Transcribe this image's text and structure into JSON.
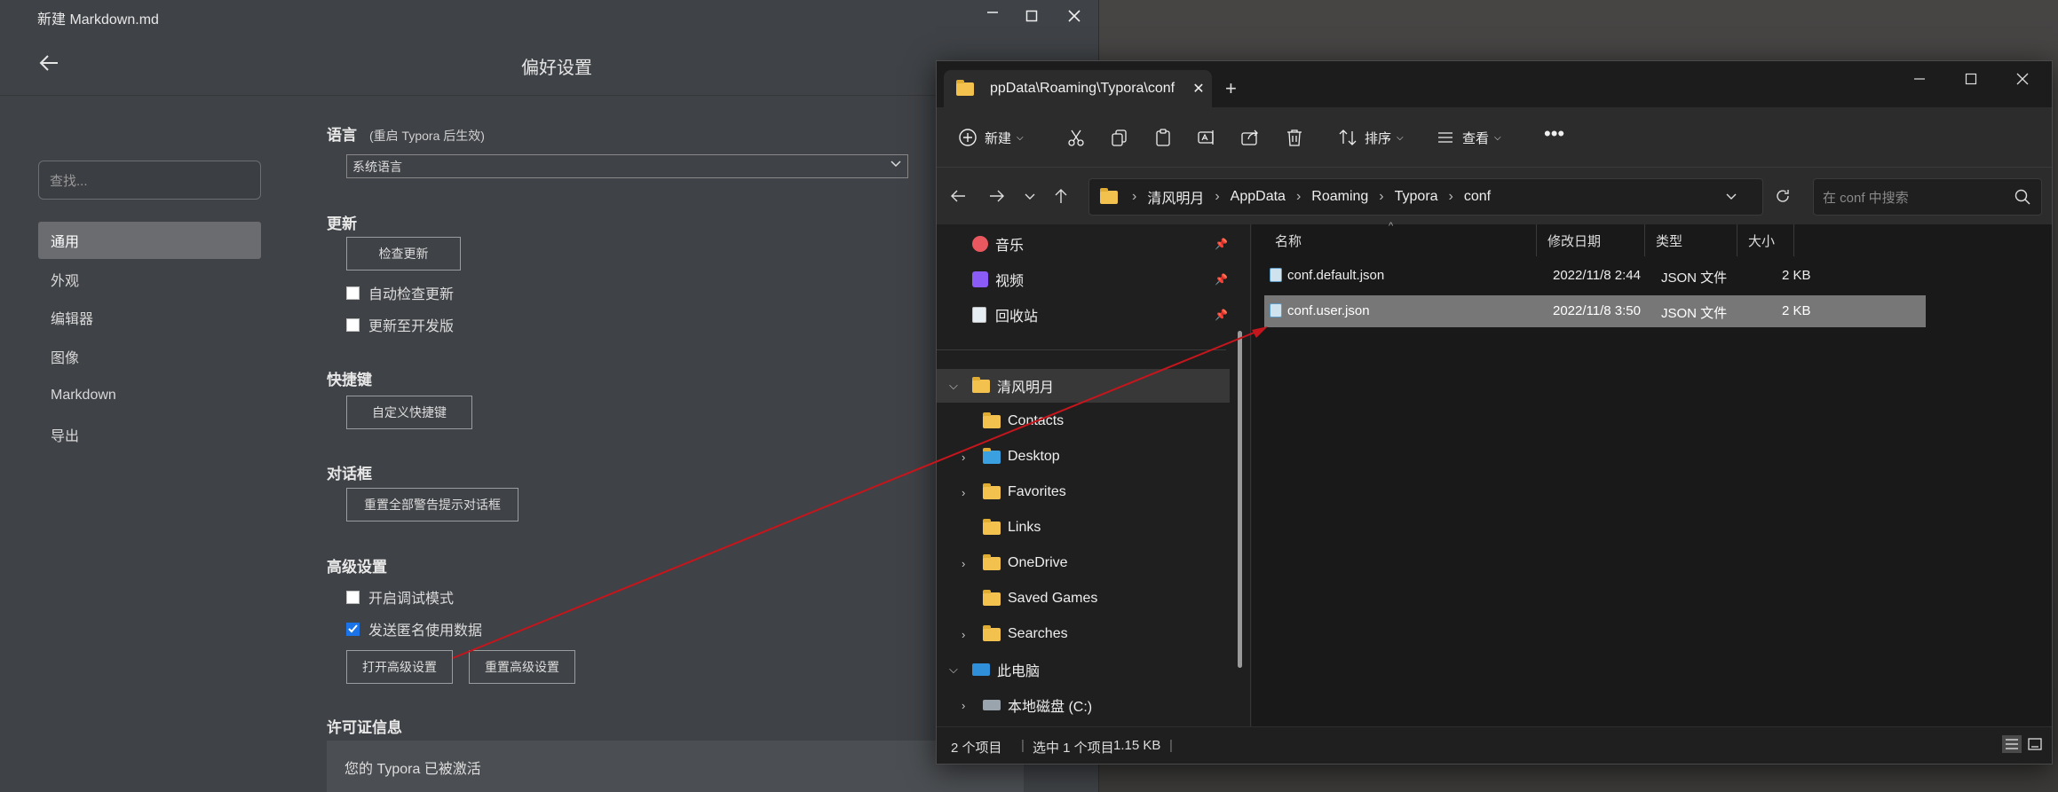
{
  "typora": {
    "window_title": "新建 Markdown.md",
    "page_title": "偏好设置",
    "search_placeholder": "查找...",
    "nav": [
      "通用",
      "外观",
      "编辑器",
      "图像",
      "Markdown",
      "导出"
    ],
    "sections": {
      "language": {
        "heading": "语言",
        "note": "(重启 Typora 后生效)",
        "selected": "系统语言"
      },
      "update": {
        "heading": "更新",
        "check_button": "检查更新",
        "auto_check": "自动检查更新",
        "dev_channel": "更新至开发版"
      },
      "shortcuts": {
        "heading": "快捷键",
        "custom_button": "自定义快捷键"
      },
      "dialogs": {
        "heading": "对话框",
        "reset_button": "重置全部警告提示对话框"
      },
      "advanced": {
        "heading": "高级设置",
        "debug_mode": "开启调试模式",
        "send_usage": "发送匿名使用数据",
        "open_button": "打开高级设置",
        "reset_button": "重置高级设置"
      },
      "license": {
        "heading": "许可证信息",
        "status": "您的 Typora 已被激活"
      }
    }
  },
  "explorer": {
    "tab_label": "ppData\\Roaming\\Typora\\conf",
    "toolbar": {
      "new": "新建",
      "sort": "排序",
      "view": "查看"
    },
    "breadcrumb": [
      "清风明月",
      "AppData",
      "Roaming",
      "Typora",
      "conf"
    ],
    "search_placeholder": "在 conf 中搜索",
    "quick_access": [
      "音乐",
      "视频",
      "回收站"
    ],
    "tree": {
      "user": "清风明月",
      "folders": [
        "Contacts",
        "Desktop",
        "Favorites",
        "Links",
        "OneDrive",
        "Saved Games",
        "Searches"
      ],
      "this_pc": "此电脑",
      "drive": "本地磁盘 (C:)"
    },
    "columns": {
      "name": "名称",
      "modified": "修改日期",
      "type": "类型",
      "size": "大小"
    },
    "files": [
      {
        "name": "conf.default.json",
        "modified": "2022/11/8 2:44",
        "type": "JSON 文件",
        "size": "2 KB"
      },
      {
        "name": "conf.user.json",
        "modified": "2022/11/8 3:50",
        "type": "JSON 文件",
        "size": "2 KB"
      }
    ],
    "status": {
      "count": "2 个项目",
      "selected": "选中 1 个项目",
      "size": "1.15 KB"
    }
  },
  "colors": {
    "annotation_arrow": "#c4161c",
    "accent_checkbox": "#1a73e8"
  }
}
